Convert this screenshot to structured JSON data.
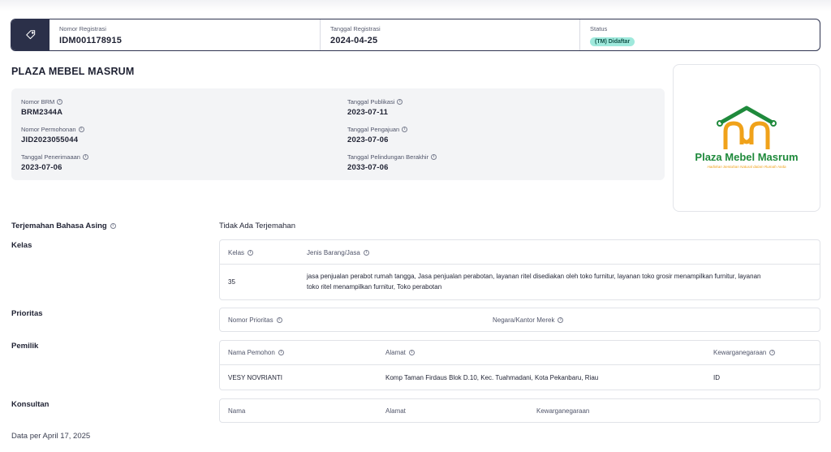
{
  "header": {
    "registration_number_label": "Nomor Registrasi",
    "registration_number": "IDM001178915",
    "registration_date_label": "Tanggal Registrasi",
    "registration_date": "2024-04-25",
    "status_label": "Status",
    "status_badge": "(TM) Didaftar"
  },
  "brand_name": "PLAZA MEBEL MASRUM",
  "details": {
    "brm_label": "Nomor BRM",
    "brm": "BRM2344A",
    "application_number_label": "Nomor Permohonan",
    "application_number": "JID2023055044",
    "receipt_date_label": "Tanggal Penerimaaan",
    "receipt_date": "2023-07-06",
    "publication_date_label": "Tanggal Publikasi",
    "publication_date": "2023-07-11",
    "filing_date_label": "Tanggal Pengajuan",
    "filing_date": "2023-07-06",
    "protection_end_label": "Tanggal Pelindungan Berakhir",
    "protection_end": "2033-07-06"
  },
  "logo": {
    "name": "Plaza Mebel Masrum",
    "tagline": "Hadirkan Sentuhan Natural dalam Rumah Anda",
    "green": "#1f8a3c",
    "orange": "#f0a21a"
  },
  "translation": {
    "label": "Terjemahan Bahasa Asing",
    "value": "Tidak Ada Terjemahan"
  },
  "classes": {
    "label": "Kelas",
    "col_class": "Kelas",
    "col_goods": "Jenis Barang/Jasa",
    "rows": [
      {
        "class": "35",
        "goods_line1": "jasa penjualan perabot rumah tangga, Jasa penjualan perabotan, layanan ritel disediakan oleh toko furnitur, layanan toko grosir menampilkan furnitur, layanan",
        "goods_line2": "toko ritel menampilkan furnitur, Toko perabotan"
      }
    ]
  },
  "priority": {
    "label": "Prioritas",
    "col_number": "Nomor Prioritas",
    "col_country": "Negara/Kantor Merek"
  },
  "owner": {
    "label": "Pemilik",
    "col_name": "Nama Pemohon",
    "col_address": "Alamat",
    "col_citizenship": "Kewarganegaraan",
    "rows": [
      {
        "name": "VESY NOVRIANTI",
        "address": "Komp Taman Firdaus Blok D.10, Kec. Tuahmadani, Kota Pekanbaru, Riau",
        "citizenship": "ID"
      }
    ]
  },
  "consultant": {
    "label": "Konsultan",
    "col_name": "Nama",
    "col_address": "Alamat",
    "col_citizenship": "Kewarganegaraan"
  },
  "footer": "Data per April 17, 2025",
  "icons": {
    "header": "tag-icon",
    "info": "info-icon"
  },
  "colors": {
    "header_dark": "#2b3049",
    "badge_bg": "#9fe9dc",
    "badge_text": "#14534a"
  }
}
